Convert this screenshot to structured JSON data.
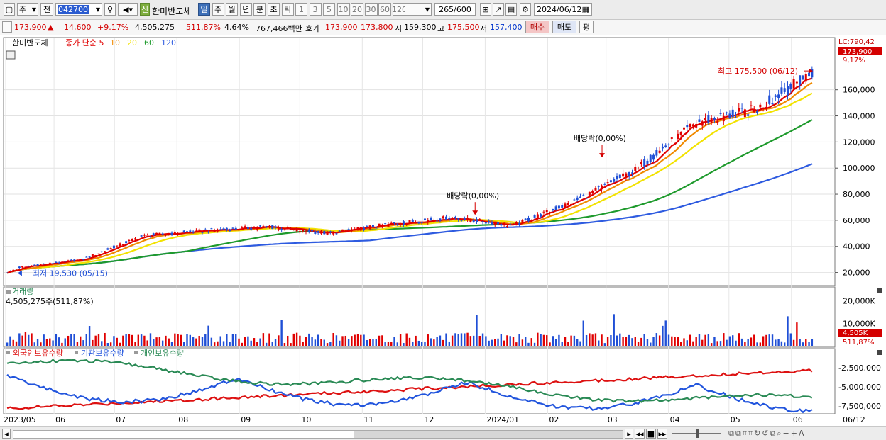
{
  "toolbar": {
    "market_type": "주",
    "prev_label": "전",
    "stock_code": "042700",
    "new_badge": "신",
    "stock_name": "한미반도체",
    "period_tabs": [
      "일",
      "주",
      "월",
      "년",
      "분",
      "초",
      "틱"
    ],
    "active_period": "일",
    "interval_tabs": [
      "1",
      "3",
      "5",
      "10",
      "20",
      "30",
      "60",
      "120"
    ],
    "count_display": "265",
    "count_total": "/600",
    "date": "2024/06/12"
  },
  "infobar": {
    "price": "173,900",
    "change_arrow": "▲",
    "change": "14,600",
    "change_pct": "+9.17%",
    "volume": "4,505,275",
    "volume_ratio": "511.87%",
    "turnover": "4.64%",
    "trade_value": "767,466백만",
    "bid_label": "호가",
    "bid_ask": "173,900",
    "bid_bid": "173,800",
    "open_label": "시",
    "open": "159,300",
    "high_label": "고",
    "high": "175,500",
    "low_label": "저",
    "low": "157,400",
    "buy_button": "매수",
    "sell_button": "매도",
    "extra_button": "평"
  },
  "chart_data": {
    "type": "candlestick",
    "title": "한미반도체",
    "legend": [
      "종가 단순 5",
      "10",
      "20",
      "60",
      "120"
    ],
    "legend_colors": {
      "5": "#e00000",
      "10": "#f08a00",
      "20": "#f2e200",
      "60": "#1e9a2c",
      "120": "#2e5be0"
    },
    "y_range": [
      10000,
      200000
    ],
    "y_ticks": [
      "160,000",
      "140,000",
      "120,000",
      "100,000",
      "80,000",
      "60,000",
      "40,000",
      "20,000"
    ],
    "y_tick_values": [
      160000,
      140000,
      120000,
      100000,
      80000,
      60000,
      40000,
      20000
    ],
    "lc_label": "LC:790,42",
    "last_price_label": "173,900",
    "last_pct_label": "9,17%",
    "annotations": [
      {
        "text": "최고 175,500 (06/12)",
        "price": 175500,
        "date": "2024/06/12"
      },
      {
        "text": "최저 19,530 (05/15)",
        "price": 19530,
        "date": "2023/05/15"
      },
      {
        "text": "배당락(0,00%)",
        "price": 62000,
        "date": "2023/12/27"
      },
      {
        "text": "배당락(0,00%)",
        "price": 106000,
        "date": "2024/02/28"
      }
    ],
    "x_labels": [
      "2023/05",
      "06",
      "07",
      "08",
      "09",
      "10",
      "11",
      "12",
      "2024/01",
      "02",
      "03",
      "04",
      "05",
      "06"
    ],
    "x_end_label": "06/12",
    "close_monthly": [
      {
        "month": "2023/05",
        "close": 24000
      },
      {
        "month": "2023/06",
        "close": 30000
      },
      {
        "month": "2023/07",
        "close": 48000
      },
      {
        "month": "2023/08",
        "close": 52000
      },
      {
        "month": "2023/09",
        "close": 55000
      },
      {
        "month": "2023/10",
        "close": 50000
      },
      {
        "month": "2023/11",
        "close": 57000
      },
      {
        "month": "2023/12",
        "close": 62000
      },
      {
        "month": "2024/01",
        "close": 56000
      },
      {
        "month": "2024/02",
        "close": 75000
      },
      {
        "month": "2024/03",
        "close": 98000
      },
      {
        "month": "2024/04",
        "close": 135000
      },
      {
        "month": "2024/05",
        "close": 145000
      },
      {
        "month": "2024/06",
        "close": 173900
      }
    ],
    "volume_panel": {
      "title": "거래량",
      "current": "4,505,275주(511,87%)",
      "y_ticks": [
        "20,000K",
        "10,000K"
      ],
      "y_tick_values": [
        20000000,
        10000000
      ],
      "last_label": "4,505K",
      "last_pct": "511,87%"
    },
    "holding_panel": {
      "series": [
        "외국인보유수량",
        "기관보유수량",
        "개인보유수량"
      ],
      "series_colors": [
        "#dd1111",
        "#2255dd",
        "#2a8a55"
      ],
      "y_ticks": [
        "-2,500,000",
        "-5,000,000",
        "-7,500,000"
      ],
      "y_tick_values": [
        -2500000,
        -5000000,
        -7500000
      ]
    }
  }
}
